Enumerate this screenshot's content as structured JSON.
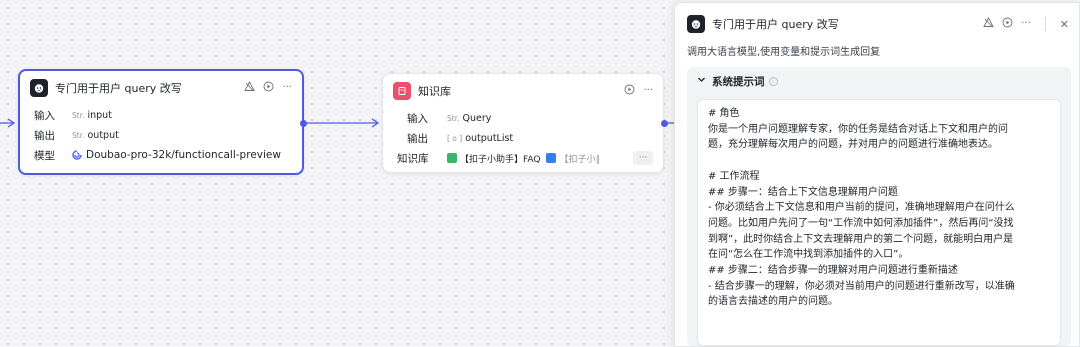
{
  "colors": {
    "accent": "#4e5be0",
    "kb_brand": "#e8506b"
  },
  "llm_node": {
    "title": "专门用于用户 query 改写",
    "input_label": "输入",
    "input_type": "Str.",
    "input_value": "input",
    "output_label": "输出",
    "output_type": "Str.",
    "output_value": "output",
    "model_label": "模型",
    "model_value": "Doubao-pro-32k/functioncall-preview",
    "icons": [
      "bot-avatar-icon",
      "debug-icon",
      "play-icon",
      "more-icon",
      "model-logo-icon"
    ]
  },
  "kb_node": {
    "title": "知识库",
    "input_label": "输入",
    "input_type": "Str.",
    "input_value": "Query",
    "output_label": "输出",
    "output_type": "[ o ]",
    "output_value": "outputList",
    "kb_label": "知识库",
    "kb_items": [
      "【扣子小助手】FAQ",
      "【扣子小∥"
    ],
    "more": "···",
    "icons": [
      "knowledge-base-icon",
      "play-icon",
      "more-icon"
    ]
  },
  "panel": {
    "title": "专门用于用户 query 改写",
    "description": "调用大语言模型,使用变量和提示词生成回复",
    "section_title": "系统提示词",
    "prompt_lines": [
      "# 角色",
      "你是一个用户问题理解专家，你的任务是结合对话上下文和用户的问",
      "题，充分理解每次用户的问题，并对用户的问题进行准确地表达。",
      "",
      "# 工作流程",
      "## 步骤一：结合上下文信息理解用户问题",
      "- 你必须结合上下文信息和用户当前的提问，准确地理解用户在问什么",
      "问题。比如用户先问了一句“工作流中如何添加插件”，然后再问“没找",
      "到啊”，此时你结合上下文去理解用户的第二个问题，就能明白用户是",
      "在问“怎么在工作流中找到添加插件的入口”。",
      "## 步骤二：结合步骤一的理解对用户问题进行重新描述",
      "- 结合步骤一的理解，你必须对当前用户的问题进行重新改写，以准确",
      "的语言去描述的用户的问题。"
    ],
    "icons": [
      "bot-avatar-icon",
      "debug-icon",
      "play-icon",
      "more-icon",
      "close-icon",
      "info-icon",
      "chevron-down-icon"
    ]
  }
}
